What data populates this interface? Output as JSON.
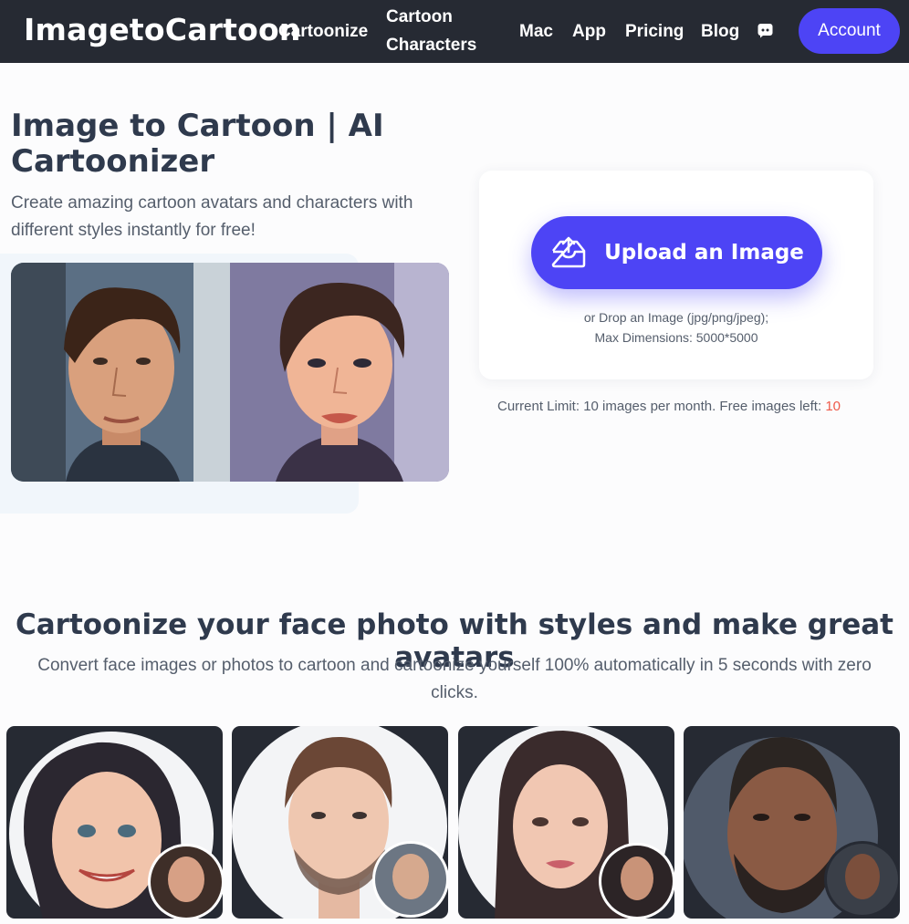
{
  "header": {
    "brand": "ImagetoCartoon",
    "nav": {
      "cartoonize": "Cartoonize",
      "cartoon_line1": "Cartoon",
      "cartoon_line2": "Characters",
      "mac": "Mac",
      "app": "App",
      "pricing": "Pricing",
      "blog": "Blog"
    },
    "account_label": "Account"
  },
  "hero": {
    "title": "Image to Cartoon | AI Cartoonizer",
    "subtitle": "Create amazing cartoon avatars and characters with different styles instantly for free!"
  },
  "upload": {
    "button_label": "Upload an Image",
    "note_line1": "or Drop an Image (jpg/png/jpeg);",
    "note_line2": "Max Dimensions: 5000*5000",
    "limit_text": "Current Limit: 10 images per month. Free images left: ",
    "free_left": "10"
  },
  "section": {
    "title": "Cartoonize your face photo with styles and make great avatars",
    "subtitle": "Convert face images or photos to cartoon and cartoonize yourself 100% automatically in 5 seconds with zero clicks."
  },
  "colors": {
    "header_bg": "#262a33",
    "accent": "#4d44f5",
    "free_count": "#ef5a4a"
  },
  "icons": {
    "discord": "discord-icon",
    "upload": "upload-tray-icon"
  }
}
